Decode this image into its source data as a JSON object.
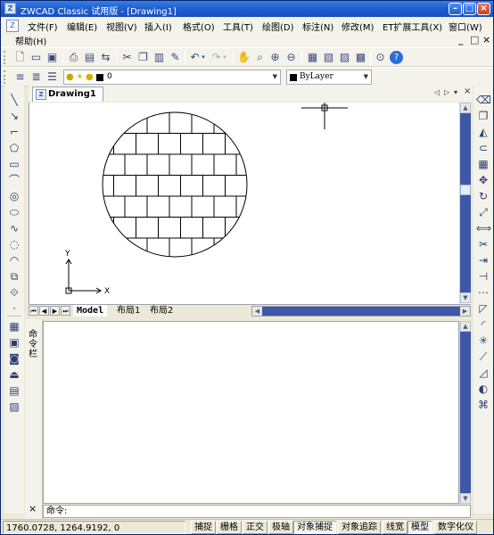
{
  "window": {
    "title": "ZWCAD Classic 试用版 - [Drawing1]"
  },
  "window_controls": {
    "minimize": "–",
    "maximize": "□",
    "close": "×"
  },
  "menu": {
    "items": [
      "文件(F)",
      "编辑(E)",
      "视图(V)",
      "插入(I)",
      "格式(O)",
      "工具(T)",
      "绘图(D)",
      "标注(N)",
      "修改(M)",
      "ET扩展工具(X)",
      "窗口(W)"
    ],
    "help": "帮助(H)",
    "doc_controls": [
      "_",
      "□",
      "×"
    ]
  },
  "layer_toolbar": {
    "layer_value": "0",
    "linetype_value": "ByLayer"
  },
  "document": {
    "tab": "Drawing1",
    "nav": [
      "◁",
      "▷",
      "▾",
      "×"
    ]
  },
  "ucs": {
    "x_label": "X",
    "y_label": "Y"
  },
  "layouts": {
    "tabs": [
      "Model",
      "布局1",
      "布局2"
    ],
    "active": "Model"
  },
  "command": {
    "side_label": "命令栏",
    "prompt": "命令:",
    "close": "×"
  },
  "status": {
    "coordinates": "1760.0728,  1264.9192,  0",
    "buttons": [
      {
        "label": "捕捉",
        "on": false
      },
      {
        "label": "栅格",
        "on": false
      },
      {
        "label": "正交",
        "on": false
      },
      {
        "label": "极轴",
        "on": false
      },
      {
        "label": "对象捕捉",
        "on": true
      },
      {
        "label": "对象追踪",
        "on": false
      },
      {
        "label": "线宽",
        "on": false
      },
      {
        "label": "模型",
        "on": true
      },
      {
        "label": "数字化仪",
        "on": false
      }
    ]
  },
  "icons": {
    "standard_toolbar": [
      "new-icon",
      "open-icon",
      "save-icon",
      "print-icon",
      "print-preview-icon",
      "publish-icon",
      "cut-icon",
      "copy-icon",
      "paste-icon",
      "match-properties-icon",
      "undo-icon",
      "redo-icon",
      "pan-icon",
      "zoom-realtime-icon",
      "zoom-window-icon",
      "zoom-previous-icon",
      "properties-icon",
      "design-center-icon",
      "tool-palette-icon",
      "calculator-icon",
      "preview-icon",
      "help-icon"
    ],
    "layer_toolbar": [
      "layer-manager-icon",
      "layer-previous-icon",
      "layer-state-icon"
    ],
    "draw_palette": [
      "line-icon",
      "ray-icon",
      "polyline-icon",
      "polygon-icon",
      "rectangle-icon",
      "arc-icon",
      "circle-icon",
      "ellipse-icon",
      "spline-icon",
      "revcloud-icon",
      "ellipse-arc-icon",
      "insert-block-icon",
      "make-block-icon",
      "point-icon",
      "hatch-icon",
      "region-icon",
      "gradient-icon",
      "boundary-icon",
      "table-icon",
      "image-icon"
    ],
    "modify_palette": [
      "erase-icon",
      "copy-object-icon",
      "mirror-icon",
      "offset-icon",
      "array-icon",
      "move-icon",
      "rotate-icon",
      "scale-icon",
      "stretch-icon",
      "trim-icon",
      "extend-icon",
      "break-icon",
      "join-icon",
      "chamfer-icon",
      "fillet-icon",
      "explode-icon",
      "lengthen-icon",
      "edit-icon",
      "layer-walk-icon",
      "match-icon"
    ]
  }
}
